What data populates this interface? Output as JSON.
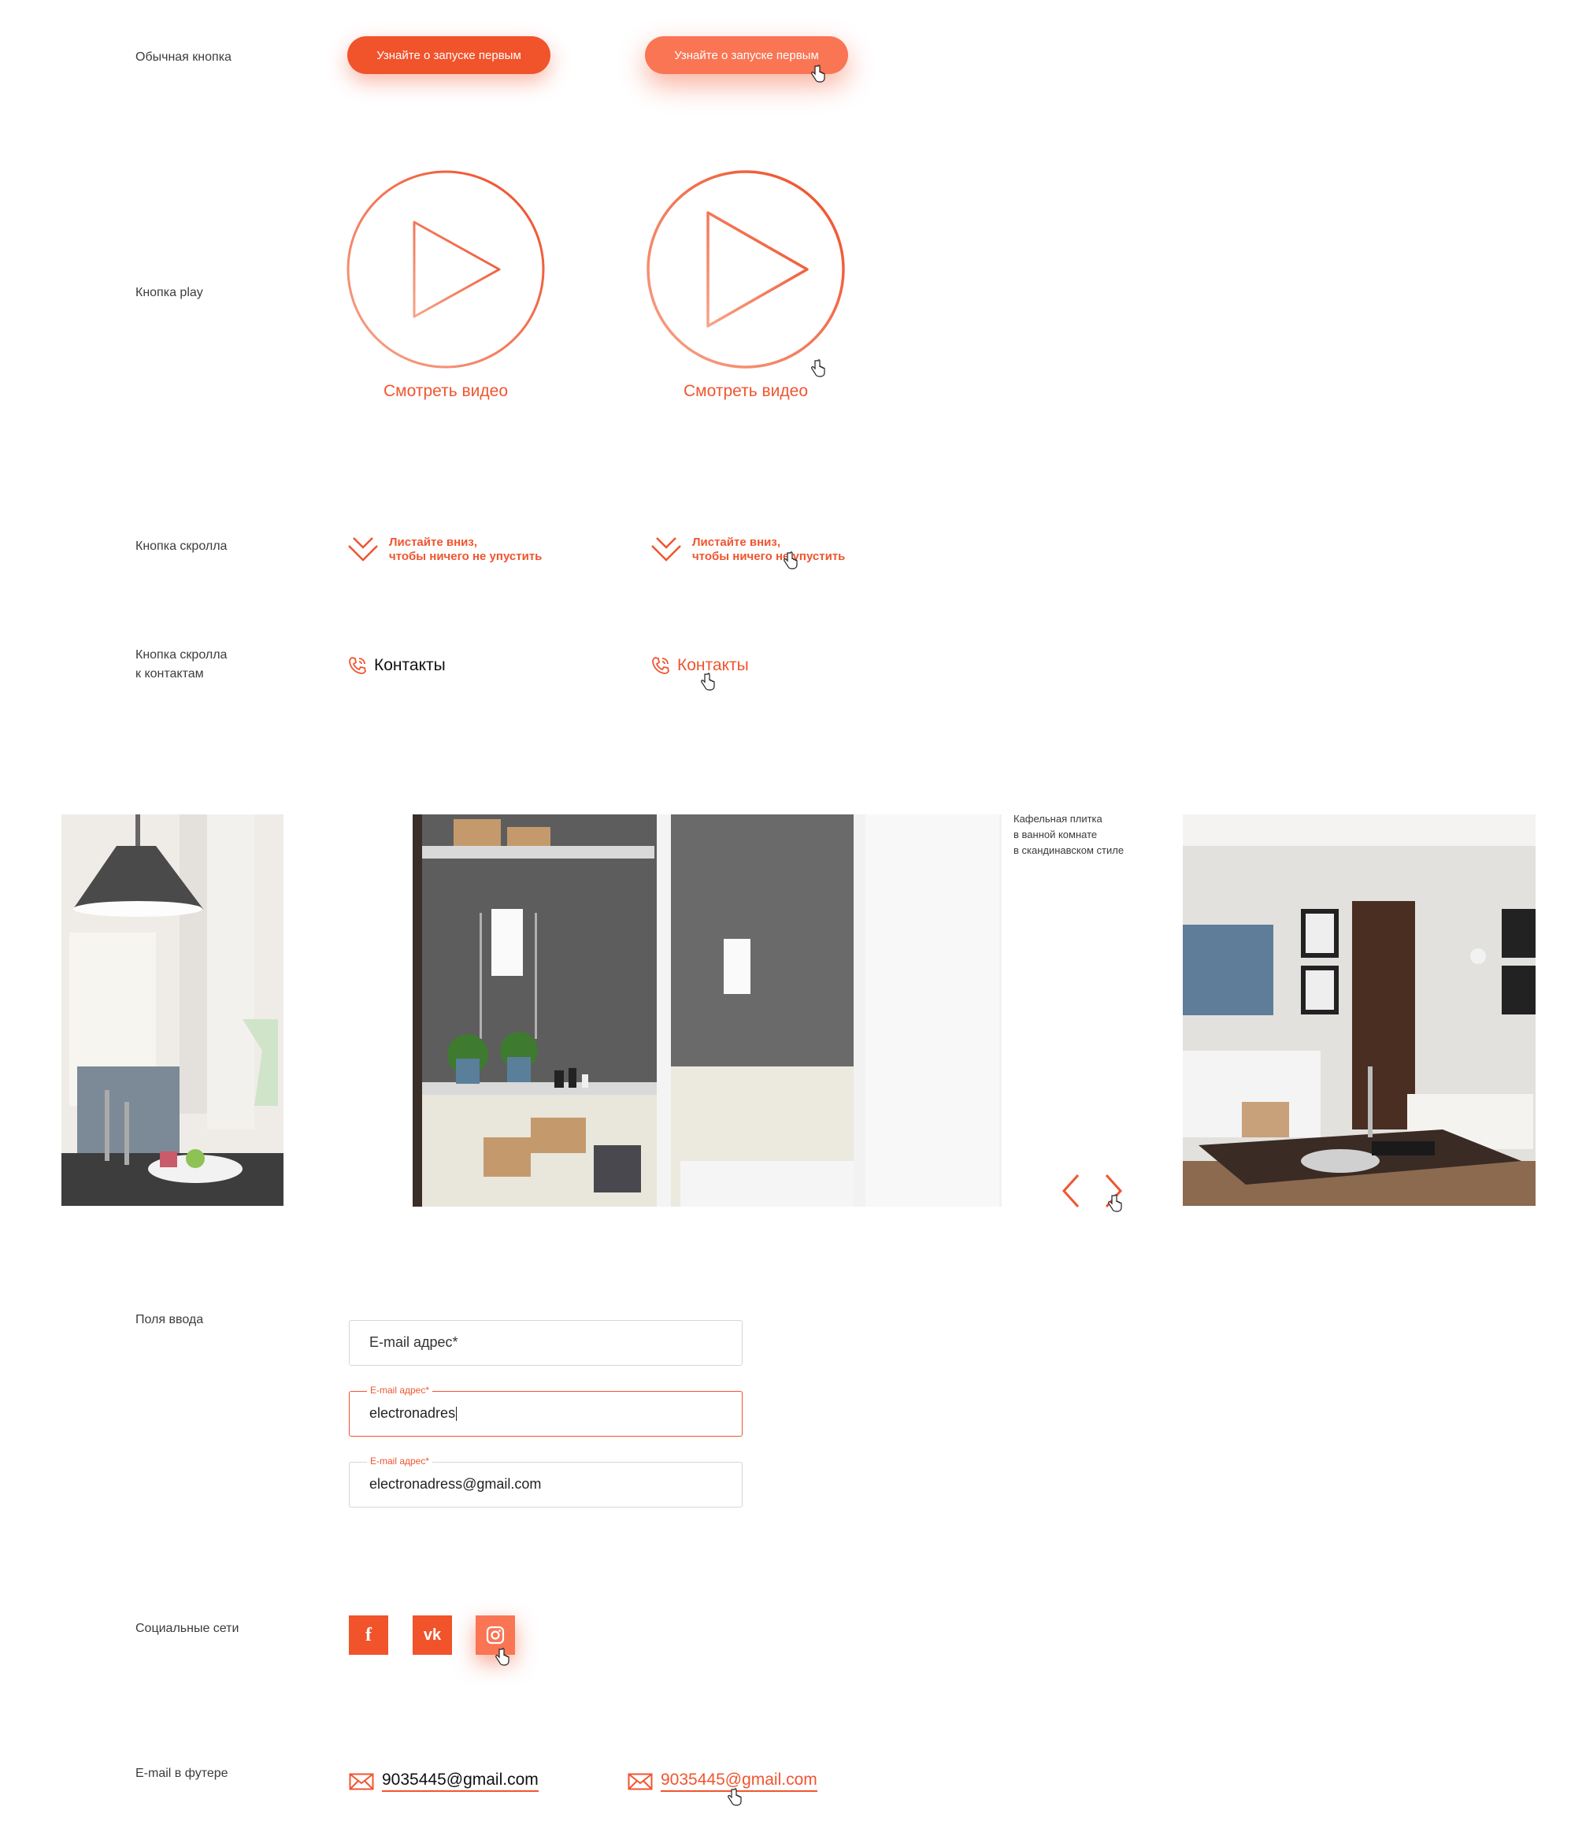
{
  "labels": {
    "regular_button": "Обычная кнопка",
    "play_button": "Кнопка play",
    "scroll_button": "Кнопка скролла",
    "scroll_to_contacts_line1": "Кнопка скролла",
    "scroll_to_contacts_line2": "к контактам",
    "input_fields": "Поля ввода",
    "social_networks": "Социальные сети",
    "footer_email": "E-mail в футере"
  },
  "cta": {
    "label": "Узнайте о запуске первым"
  },
  "play": {
    "caption": "Смотреть видео"
  },
  "scroll": {
    "line1": "Листайте вниз,",
    "line2": "чтобы ничего не упустить"
  },
  "contacts": {
    "label": "Контакты"
  },
  "gallery": {
    "caption_line1": "Кафельная плитка",
    "caption_line2": "в ванной комнате",
    "caption_line3": "в скандинавском стиле"
  },
  "inputs": [
    {
      "placeholder": "E-mail адрес*",
      "value": "",
      "floating_label": ""
    },
    {
      "placeholder": "",
      "value": "electronadres",
      "floating_label": "E-mail адрес*"
    },
    {
      "placeholder": "",
      "value": "electronadress@gmail.com",
      "floating_label": "E-mail адрес*"
    }
  ],
  "social": {
    "facebook": "f",
    "vk": "vk",
    "instagram": "instagram-icon"
  },
  "footer": {
    "email": "9035445@gmail.com"
  },
  "colors": {
    "accent": "#f1532b",
    "accent_hover": "#f97554",
    "text": "#2b2b2b"
  }
}
